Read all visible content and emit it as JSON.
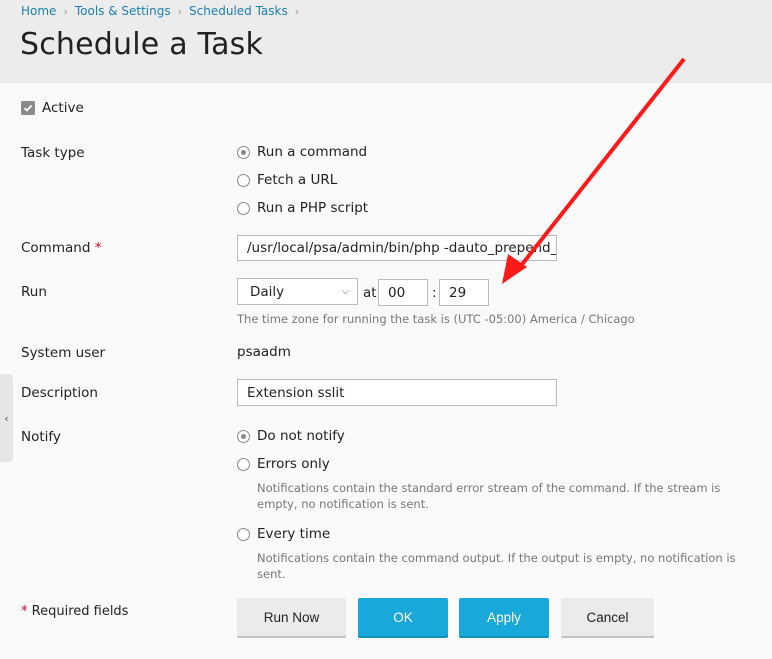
{
  "breadcrumb": [
    {
      "label": "Home"
    },
    {
      "label": "Tools & Settings"
    },
    {
      "label": "Scheduled Tasks"
    }
  ],
  "page_title": "Schedule a Task",
  "active": {
    "label": "Active",
    "checked": true
  },
  "task_type": {
    "label": "Task type",
    "options": [
      {
        "label": "Run a command",
        "selected": true
      },
      {
        "label": "Fetch a URL",
        "selected": false
      },
      {
        "label": "Run a PHP script",
        "selected": false
      }
    ]
  },
  "command": {
    "label": "Command",
    "required_mark": "*",
    "value": "/usr/local/psa/admin/bin/php -dauto_prepend_"
  },
  "run": {
    "label": "Run",
    "frequency": "Daily",
    "at_label": "at",
    "hour": "00",
    "colon": ":",
    "minute": "29",
    "timezone_hint": "The time zone for running the task is (UTC -05:00) America / Chicago"
  },
  "system_user": {
    "label": "System user",
    "value": "psaadm"
  },
  "description": {
    "label": "Description",
    "value": "Extension sslit"
  },
  "notify": {
    "label": "Notify",
    "options": [
      {
        "label": "Do not notify",
        "selected": true,
        "hint": ""
      },
      {
        "label": "Errors only",
        "selected": false,
        "hint": "Notifications contain the standard error stream of the command. If the stream is empty, no notification is sent."
      },
      {
        "label": "Every time",
        "selected": false,
        "hint": "Notifications contain the command output. If the output is empty, no notification is sent."
      }
    ]
  },
  "footer": {
    "required_mark": "*",
    "required_text": "Required fields",
    "buttons": {
      "run_now": "Run Now",
      "ok": "OK",
      "apply": "Apply",
      "cancel": "Cancel"
    }
  },
  "colors": {
    "primary": "#18a9da",
    "link": "#1c7fb0",
    "required": "#d0021b",
    "annotation": "#ff1a1a"
  },
  "icons": {
    "breadcrumb_separator": "chevron-right-icon",
    "side_toggle": "chevron-left-icon",
    "select_arrow": "chevron-down-icon"
  }
}
